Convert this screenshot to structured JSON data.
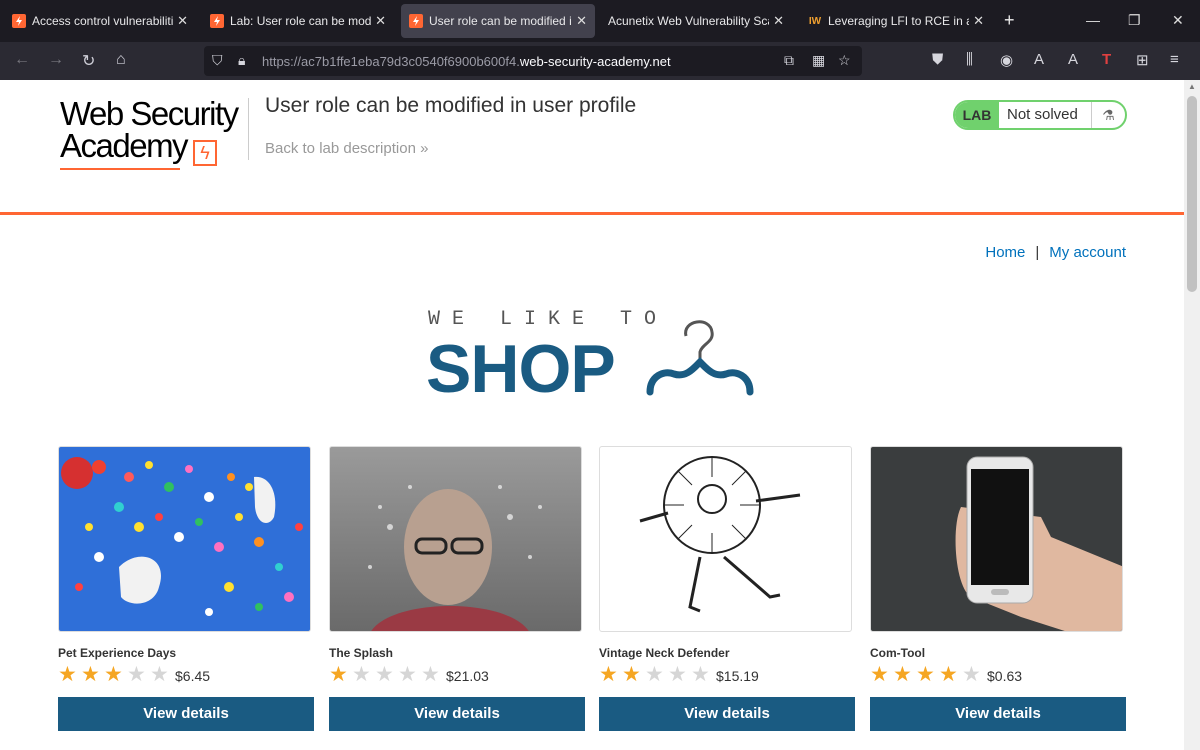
{
  "browser": {
    "tabs": [
      {
        "title": "Access control vulnerabilities",
        "favicon": "lightning-icon"
      },
      {
        "title": "Lab: User role can be modified in user profile",
        "favicon": "lightning-icon"
      },
      {
        "title": "User role can be modified in user profile",
        "favicon": "lightning-icon",
        "active": true
      },
      {
        "title": "Acunetix Web Vulnerability Scanner",
        "favicon": ""
      },
      {
        "title": "Leveraging LFI to RCE in a website",
        "favicon": "IW"
      }
    ],
    "url_prefix": "https://ac7b1ffe1eba79d3c0540f6900b600f4.",
    "url_domain": "web-security-academy.net"
  },
  "header": {
    "logo_line1": "Web Security",
    "logo_line2": "Academy",
    "lab_title": "User role can be modified in user profile",
    "back_link": "Back to lab description",
    "badge_label": "LAB",
    "badge_status": "Not solved"
  },
  "nav": {
    "home": "Home",
    "separator": "|",
    "account": "My account"
  },
  "hero": {
    "tagline": "WE LIKE TO",
    "title": "SHOP"
  },
  "products": [
    {
      "name": "Pet Experience Days",
      "rating": 3,
      "price": "$6.45",
      "button": "View details"
    },
    {
      "name": "The Splash",
      "rating": 1,
      "price": "$21.03",
      "button": "View details"
    },
    {
      "name": "Vintage Neck Defender",
      "rating": 2,
      "price": "$15.19",
      "button": "View details"
    },
    {
      "name": "Com-Tool",
      "rating": 4,
      "price": "$0.63",
      "button": "View details"
    }
  ],
  "colors": {
    "accent": "#ff6633",
    "primary": "#1a5b82",
    "link": "#0071bc",
    "lab_green": "#70d16d",
    "star": "#f5a623"
  }
}
